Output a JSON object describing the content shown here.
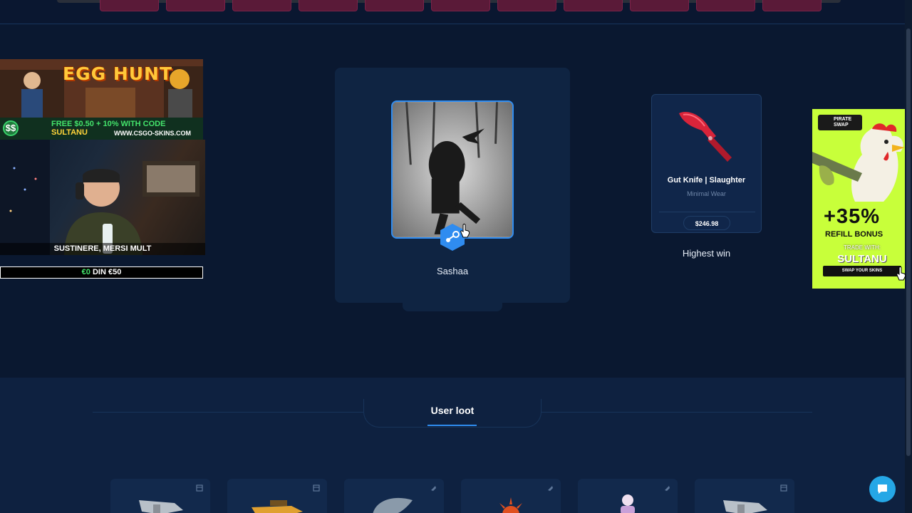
{
  "profile": {
    "username": "Sashaa",
    "badge_icon": "steam-icon"
  },
  "highest_win": {
    "item_name": "Gut Knife | Slaughter",
    "wear": "Minimal Wear",
    "price": "$246.98",
    "label": "Highest win"
  },
  "stream_overlay": {
    "banner_title": "EGG HUNT",
    "promo_text": "FREE $0.50 + 10% WITH CODE",
    "promo_code": "SULTANU",
    "promo_site": "WWW.CSGO-SKINS.COM",
    "egg_icon_text": "$$",
    "webcam_caption": "SUSTINERE, MERSI MULT",
    "donation_current": "€0",
    "donation_goal": "DIN €50"
  },
  "pirate_ad": {
    "brand": "PIRATE SWAP",
    "bonus": "+35%",
    "bonus_label": "REFILL BONUS",
    "trade_with": "TRADE WITH:",
    "code": "SULTANU",
    "button": "SWAP YOUR SKINS"
  },
  "loot": {
    "tab_label": "User loot"
  },
  "colors": {
    "accent": "#2f8cf0",
    "background": "#0b1a33",
    "card": "#10264a",
    "chat": "#25a7e6",
    "ad_green": "#c8ff3a"
  }
}
